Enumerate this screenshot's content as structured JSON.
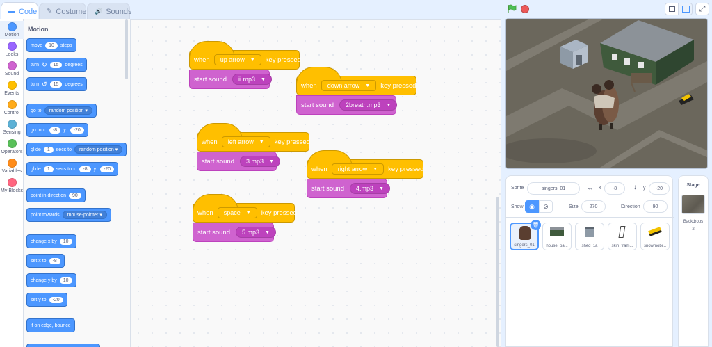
{
  "tabs": {
    "code": "Code",
    "costumes": "Costumes",
    "sounds": "Sounds"
  },
  "categories": [
    {
      "label": "Motion",
      "color": "#4c97ff"
    },
    {
      "label": "Looks",
      "color": "#9966ff"
    },
    {
      "label": "Sound",
      "color": "#cf63cf"
    },
    {
      "label": "Events",
      "color": "#ffbf00"
    },
    {
      "label": "Control",
      "color": "#ffab19"
    },
    {
      "label": "Sensing",
      "color": "#5cb1d6"
    },
    {
      "label": "Operators",
      "color": "#59c059"
    },
    {
      "label": "Variables",
      "color": "#ff8c1a"
    },
    {
      "label": "My Blocks",
      "color": "#ff6680"
    }
  ],
  "palette": {
    "title": "Motion",
    "move": {
      "a": "move",
      "v": "10",
      "b": "steps"
    },
    "turn_right": {
      "a": "turn",
      "icon": "↻",
      "v": "15",
      "b": "degrees"
    },
    "turn_left": {
      "a": "turn",
      "icon": "↺",
      "v": "15",
      "b": "degrees"
    },
    "goto": {
      "a": "go to",
      "dd": "random position"
    },
    "goto_xy": {
      "a": "go to x:",
      "x": "-8",
      "b": "y:",
      "y": "-20"
    },
    "glide": {
      "a": "glide",
      "v": "1",
      "b": "secs to",
      "dd": "random position"
    },
    "glide_xy": {
      "a": "glide",
      "v": "1",
      "b": "secs to x:",
      "x": "-8",
      "c": "y:",
      "y": "-20"
    },
    "point_dir": {
      "a": "point in direction",
      "v": "90"
    },
    "point_towards": {
      "a": "point towards",
      "dd": "mouse-pointer"
    },
    "change_x": {
      "a": "change x by",
      "v": "10"
    },
    "set_x": {
      "a": "set x to",
      "v": "-8"
    },
    "change_y": {
      "a": "change y by",
      "v": "10"
    },
    "set_y": {
      "a": "set y to",
      "v": "-20"
    },
    "bounce": "if on edge, bounce"
  },
  "scripts": [
    {
      "when": "when",
      "key": "up arrow",
      "pressed": "key pressed",
      "start": "start sound",
      "sound": "ii.mp3"
    },
    {
      "when": "when",
      "key": "down arrow",
      "pressed": "key pressed",
      "start": "start sound",
      "sound": "2breath.mp3"
    },
    {
      "when": "when",
      "key": "left arrow",
      "pressed": "key pressed",
      "start": "start sound",
      "sound": "3.mp3"
    },
    {
      "when": "when",
      "key": "right arrow",
      "pressed": "key pressed",
      "start": "start sound",
      "sound": "4.mp3"
    },
    {
      "when": "when",
      "key": "space",
      "pressed": "key pressed",
      "start": "start sound",
      "sound": "5.mp3"
    }
  ],
  "sprite_info": {
    "sprite_label": "Sprite",
    "sprite_name": "singers_01",
    "x_label": "x",
    "x_value": "-8",
    "y_label": "y",
    "y_value": "-20",
    "show_label": "Show",
    "size_label": "Size",
    "size_value": "270",
    "direction_label": "Direction",
    "direction_value": "90"
  },
  "sprites": [
    "singers_01",
    "house_ba...",
    "shed_1a",
    "skin_fram...",
    "snowmobi..."
  ],
  "stage_panel": {
    "title": "Stage",
    "backdrops_label": "Backdrops",
    "backdrops_count": "2"
  },
  "colors": {
    "motion": "#4c97ff",
    "events": "#ffbf00",
    "sound": "#cf63cf",
    "accent": "#4c97ff"
  }
}
